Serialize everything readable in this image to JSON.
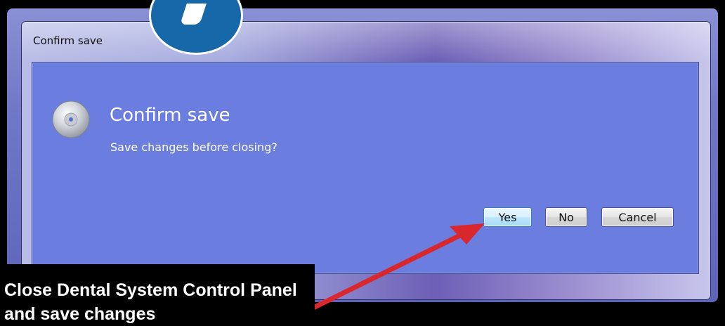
{
  "window": {
    "title": "Confirm save"
  },
  "dialog": {
    "heading": "Confirm save",
    "message": "Save changes before closing?",
    "icon": "disc-icon"
  },
  "buttons": {
    "yes": "Yes",
    "no": "No",
    "cancel": "Cancel"
  },
  "overlay": {
    "caption": "Close Dental System Control Panel and save changes",
    "arrow_color": "#d8282e",
    "logo_color": "#1768a8"
  }
}
